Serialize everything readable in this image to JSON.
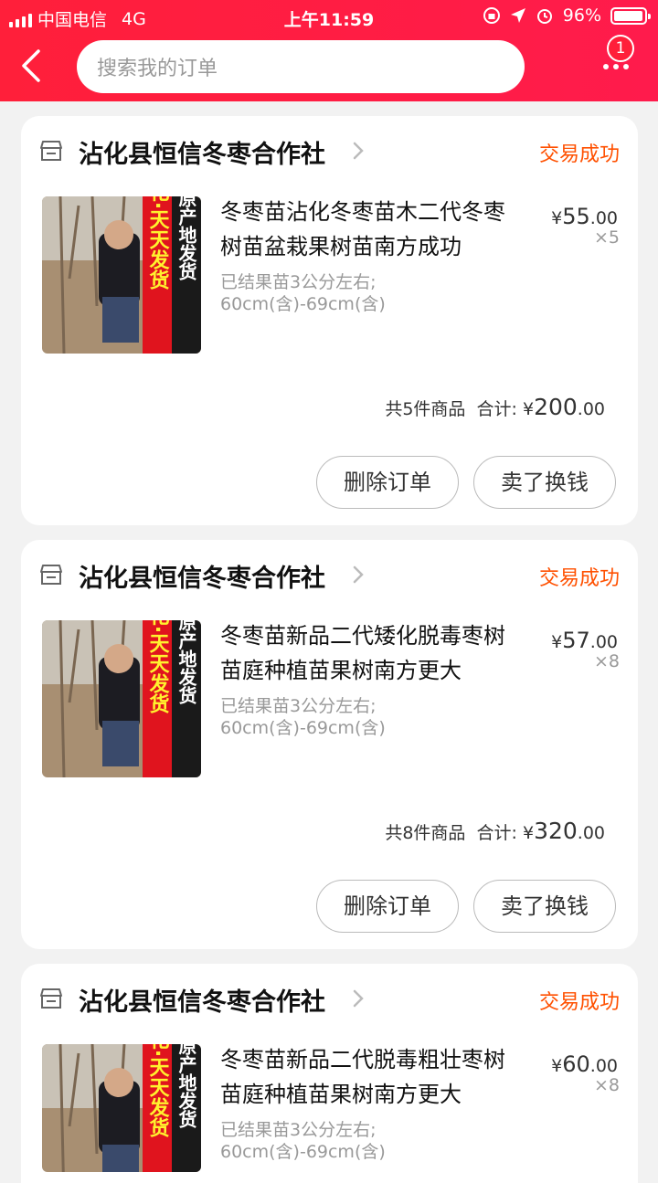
{
  "status_bar": {
    "carrier": "中国电信",
    "network": "4G",
    "time": "上午11:59",
    "battery": "96%"
  },
  "nav": {
    "search_placeholder": "搜索我的订单",
    "badge_count": "1"
  },
  "orders": [
    {
      "shop": "沾化县恒信冬枣合作社",
      "status": "交易成功",
      "title": "冬枣苗沾化冬枣苗木二代冬枣树苗盆栽果树苗南方成功",
      "sku_line1": "已结果苗3公分左右;",
      "sku_line2": "60cm(含)-69cm(含)",
      "price_int": "55",
      "price_dec": ".00",
      "qty": "×5",
      "count_text": "共5件商品",
      "total_label": "合计:",
      "total_int": "200",
      "total_dec": ".00",
      "delete_label": "删除订单",
      "sell_label": "卖了换钱"
    },
    {
      "shop": "沾化县恒信冬枣合作社",
      "status": "交易成功",
      "title": "冬枣苗新品二代矮化脱毒枣树苗庭种植苗果树南方更大",
      "sku_line1": "已结果苗3公分左右;",
      "sku_line2": "60cm(含)-69cm(含)",
      "price_int": "57",
      "price_dec": ".00",
      "qty": "×8",
      "count_text": "共8件商品",
      "total_label": "合计:",
      "total_int": "320",
      "total_dec": ".00",
      "delete_label": "删除订单",
      "sell_label": "卖了换钱"
    },
    {
      "shop": "沾化县恒信冬枣合作社",
      "status": "交易成功",
      "title": "冬枣苗新品二代脱毒粗壮枣树苗庭种植苗果树南方更大",
      "sku_line1": "已结果苗3公分左右;",
      "sku_line2": "60cm(含)-69cm(含)",
      "price_int": "60",
      "price_dec": ".00",
      "qty": "×8"
    }
  ],
  "thumb_text": {
    "left": "沾化·天天发货",
    "right": "冬枣原产地发货"
  },
  "colors": {
    "brand": "#ff1f3a",
    "status": "#ff5000"
  },
  "icons": {
    "back": "chevron-left-icon",
    "more": "more-dots-icon",
    "shop": "shop-icon",
    "shop_arrow": "chevron-right-icon"
  }
}
